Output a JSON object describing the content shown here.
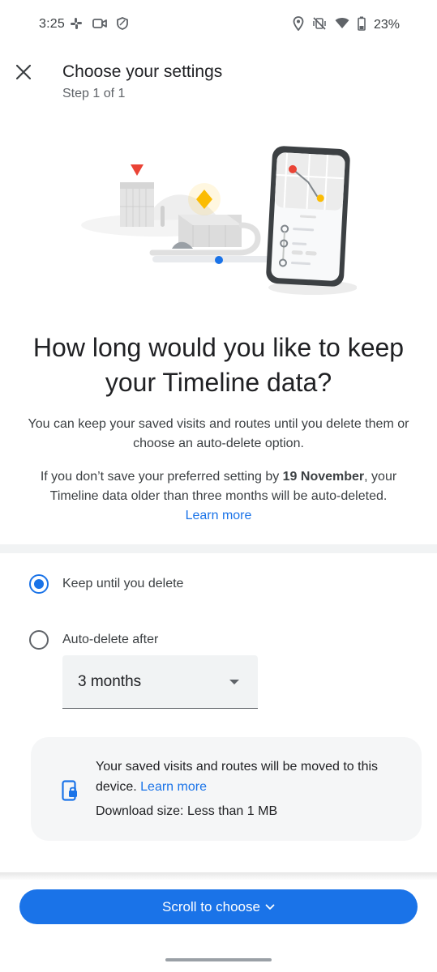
{
  "status_bar": {
    "time": "3:25",
    "battery": "23%",
    "left_icons": [
      "slack-icon",
      "video-icon",
      "shield-icon"
    ],
    "right_icons": [
      "location-icon",
      "vibrate-off-icon",
      "wifi-icon",
      "battery-icon"
    ]
  },
  "header": {
    "title": "Choose your settings",
    "step": "Step 1 of 1"
  },
  "question": "How long would you like to keep your Timeline data?",
  "description": "You can keep your saved visits and routes until you delete them or choose an auto-delete option.",
  "notice": {
    "prefix": "If you don’t save your preferred setting by ",
    "date": "19 November",
    "suffix": ", your Timeline data older than three months will be auto-deleted.",
    "link": "Learn more"
  },
  "options": [
    {
      "label": "Keep until you delete",
      "selected": true
    },
    {
      "label": "Auto-delete after",
      "selected": false
    }
  ],
  "dropdown": {
    "value": "3 months"
  },
  "info_card": {
    "text": "Your saved visits and routes will be moved to this device.",
    "link": "Learn more",
    "download_size": "Download size: Less than 1 MB"
  },
  "scroll_button": {
    "label": "Scroll to choose"
  },
  "colors": {
    "accent": "#1a73e8",
    "card": "#f5f6f7",
    "divider": "#f1f3f4"
  }
}
